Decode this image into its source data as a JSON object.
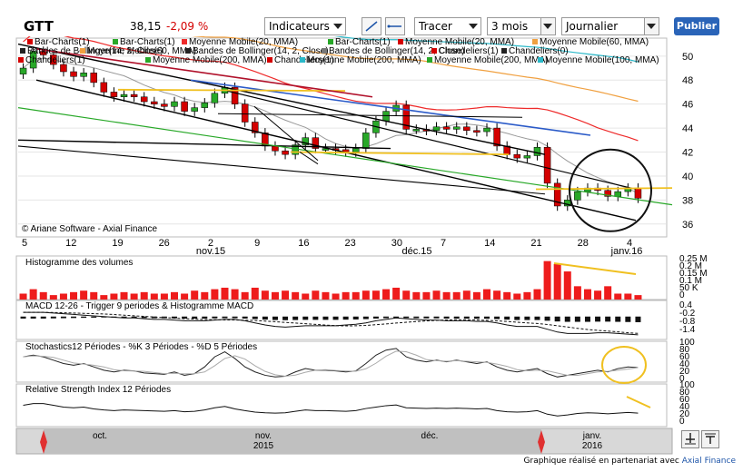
{
  "toolbar": {
    "ticker": "GTT",
    "price": "38,15",
    "change": "-2,09 %",
    "indicators_label": "Indicateurs",
    "draw_label": "Tracer",
    "period_value": "3 mois",
    "interval_value": "Journalier",
    "publish_label": "Publier"
  },
  "legend": [
    {
      "label": "Bar-Charts(1)",
      "color": "#d40000"
    },
    {
      "label": "Bar-Charts(1)",
      "color": "#28a828"
    },
    {
      "label": "Moyenne Mobile(20, MMA)",
      "color": "#ee2a2a"
    },
    {
      "label": "Bar-Charts(1)",
      "color": "#28a828"
    },
    {
      "label": "Moyenne Mobile(20, MMA)",
      "color": "#d40000"
    },
    {
      "label": "Moyenne Mobile(60, MMA)",
      "color": "#f0a040"
    },
    {
      "label": "Bandes de Bollinger(14, 2, Close)",
      "color": "#222222"
    },
    {
      "label": "Moyenne Mobile(60, MMA)",
      "color": "#f0a040"
    },
    {
      "label": "Bandes de Bollinger(14, 2, Close)",
      "color": "#222222"
    },
    {
      "label": "Bandes de Bollinger(14, 2, Close)",
      "color": "#777777"
    },
    {
      "label": "Chandeliers(1)",
      "color": "#d40000"
    },
    {
      "label": "Chandeliers(0)",
      "color": "#222222"
    },
    {
      "label": "Chandeliers(1)",
      "color": "#d40000"
    },
    {
      "label": "Moyenne Mobile(200, MMA)",
      "color": "#28a828"
    },
    {
      "label": "Chandeliers(1)",
      "color": "#d40000"
    },
    {
      "label": "Moyenne Mobile(200, MMA)",
      "color": "#2ab8c8"
    },
    {
      "label": "Moyenne Mobile(200, MMA)",
      "color": "#28a828"
    },
    {
      "label": "Moyenne Mobile(100, MMA)",
      "color": "#2ab8c8"
    }
  ],
  "copyright": "© Ariane Software - Axial Finance",
  "price_axis": [
    "50",
    "48",
    "46",
    "44",
    "42",
    "40",
    "38",
    "36"
  ],
  "date_ticks": [
    "5",
    "12",
    "19",
    "26",
    "2",
    "9",
    "16",
    "23",
    "30",
    "7",
    "14",
    "21",
    "28",
    "4"
  ],
  "month_labels": [
    "nov.15",
    "déc.15",
    "janv.16"
  ],
  "panels": {
    "volume": {
      "title": "Histogramme des volumes",
      "axis": [
        "0.25 M",
        "0.2 M",
        "0.15 M",
        "0.1 M",
        "50 K",
        "0"
      ]
    },
    "macd": {
      "title": "MACD 12-26 - Trigger 9 periodes & Histogramme MACD",
      "axis": [
        "0.4",
        "-0.2",
        "-0.8",
        "-1.4"
      ]
    },
    "stoch": {
      "title": "Stochastics12 Périodes  -  %K 3 Périodes  -  %D 5 Périodes",
      "axis": [
        "100",
        "80",
        "60",
        "40",
        "20",
        "0"
      ]
    },
    "rsi": {
      "title": "Relative Strength Index 12 Périodes",
      "axis": [
        "100",
        "80",
        "60",
        "40",
        "20",
        "0"
      ]
    }
  },
  "navigator": {
    "months": [
      "oct.",
      "nov.",
      "déc.",
      "janv."
    ],
    "years": [
      "2015",
      "2016"
    ]
  },
  "footer": {
    "text": "Graphique réalisé en partenariat avec ",
    "brand": "Axial Finance"
  },
  "chart_data": {
    "type": "candlestick",
    "period": "3 mois",
    "interval": "Journalier",
    "last_close": 38.15,
    "ylim": [
      36,
      51
    ],
    "closes": [
      49.0,
      50.4,
      50.1,
      49.3,
      48.7,
      48.3,
      48.6,
      47.8,
      47.0,
      46.6,
      46.8,
      46.6,
      46.2,
      46.0,
      45.8,
      46.2,
      45.4,
      45.7,
      46.1,
      46.9,
      47.4,
      46.0,
      44.5,
      43.6,
      42.5,
      42.1,
      41.8,
      42.6,
      43.2,
      42.3,
      42.3,
      42.2,
      42.0,
      42.3,
      43.6,
      44.6,
      45.4,
      45.9,
      43.9,
      43.9,
      43.8,
      44.1,
      43.9,
      44.1,
      43.8,
      43.7,
      44.0,
      42.5,
      41.8,
      41.5,
      41.7,
      42.4,
      39.4,
      37.5,
      38.0,
      38.7,
      39.0,
      38.8,
      38.3,
      38.7,
      39.0,
      38.15
    ],
    "volume_series": [
      0.04,
      0.07,
      0.05,
      0.03,
      0.04,
      0.05,
      0.06,
      0.05,
      0.03,
      0.04,
      0.05,
      0.04,
      0.05,
      0.04,
      0.04,
      0.05,
      0.04,
      0.06,
      0.05,
      0.07,
      0.08,
      0.07,
      0.05,
      0.08,
      0.06,
      0.05,
      0.06,
      0.05,
      0.04,
      0.06,
      0.05,
      0.04,
      0.05,
      0.05,
      0.06,
      0.06,
      0.07,
      0.08,
      0.06,
      0.05,
      0.05,
      0.06,
      0.05,
      0.05,
      0.06,
      0.05,
      0.07,
      0.06,
      0.05,
      0.04,
      0.05,
      0.07,
      0.26,
      0.24,
      0.19,
      0.09,
      0.07,
      0.06,
      0.09,
      0.04,
      0.04,
      0.03
    ],
    "macd": [
      0.3,
      0.3,
      0.3,
      0.25,
      0.2,
      0.15,
      0.1,
      0.05,
      0.0,
      -0.05,
      -0.1,
      -0.1,
      -0.15,
      -0.2,
      -0.2,
      -0.25,
      -0.3,
      -0.3,
      -0.3,
      -0.25,
      -0.2,
      -0.2,
      -0.3,
      -0.45,
      -0.6,
      -0.7,
      -0.75,
      -0.7,
      -0.65,
      -0.65,
      -0.65,
      -0.65,
      -0.6,
      -0.55,
      -0.45,
      -0.3,
      -0.2,
      -0.1,
      -0.15,
      -0.2,
      -0.25,
      -0.25,
      -0.3,
      -0.3,
      -0.3,
      -0.35,
      -0.35,
      -0.45,
      -0.6,
      -0.7,
      -0.7,
      -0.7,
      -0.9,
      -1.1,
      -1.2,
      -1.2,
      -1.2,
      -1.15,
      -1.15,
      -1.2,
      -1.25,
      -1.3
    ],
    "stoch_k": [
      70,
      75,
      70,
      60,
      50,
      45,
      50,
      40,
      30,
      25,
      30,
      28,
      22,
      20,
      18,
      25,
      15,
      20,
      40,
      70,
      85,
      65,
      40,
      25,
      15,
      10,
      12,
      25,
      35,
      30,
      30,
      28,
      25,
      28,
      50,
      75,
      90,
      95,
      70,
      60,
      55,
      60,
      55,
      60,
      55,
      50,
      55,
      40,
      30,
      25,
      30,
      35,
      20,
      10,
      15,
      20,
      25,
      30,
      25,
      35,
      40,
      38
    ],
    "rsi": [
      55,
      60,
      60,
      55,
      50,
      48,
      50,
      45,
      42,
      40,
      42,
      41,
      40,
      39,
      38,
      40,
      37,
      38,
      42,
      48,
      52,
      45,
      40,
      36,
      34,
      33,
      34,
      38,
      42,
      40,
      40,
      39,
      38,
      40,
      46,
      50,
      54,
      56,
      48,
      47,
      46,
      47,
      46,
      47,
      46,
      45,
      46,
      40,
      37,
      36,
      37,
      40,
      30,
      25,
      28,
      32,
      34,
      33,
      31,
      33,
      35,
      33
    ]
  }
}
